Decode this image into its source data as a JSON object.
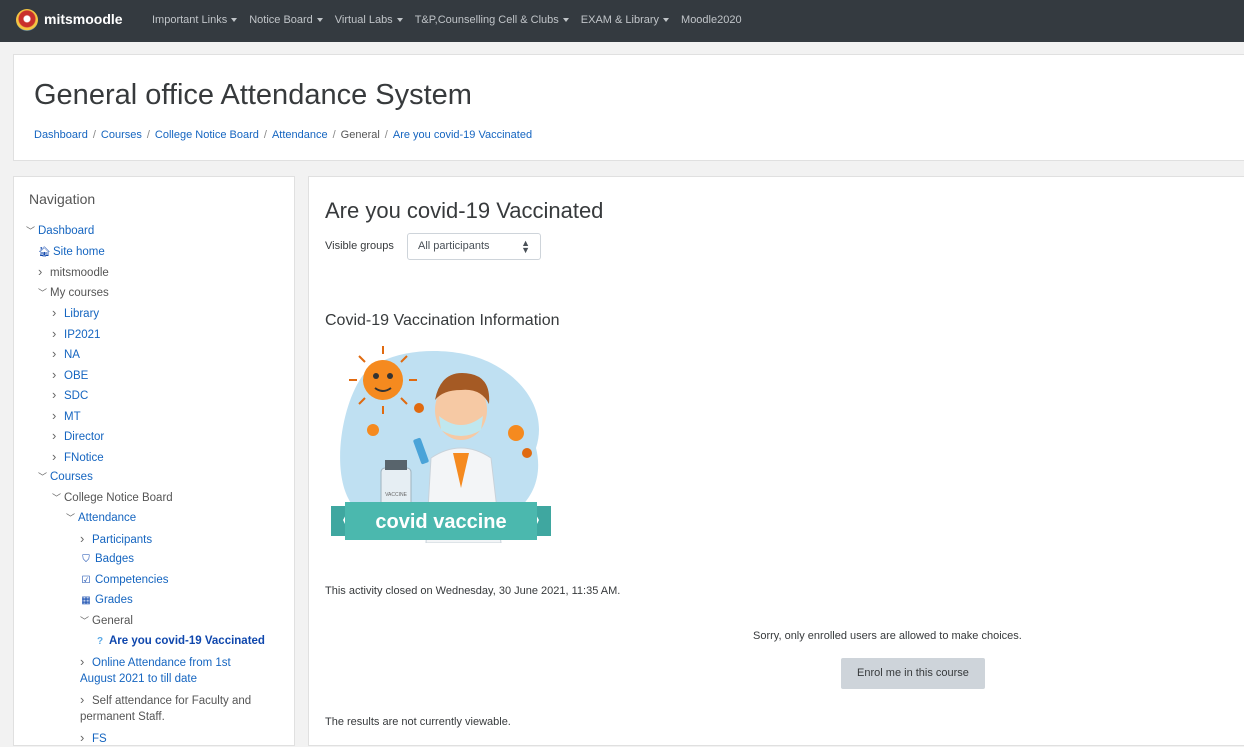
{
  "topbar": {
    "brand": "mitsmoodle",
    "menu": [
      {
        "label": "Important Links",
        "dropdown": true
      },
      {
        "label": "Notice Board",
        "dropdown": true
      },
      {
        "label": "Virtual Labs",
        "dropdown": true
      },
      {
        "label": "T&P,Counselling Cell & Clubs",
        "dropdown": true
      },
      {
        "label": "EXAM & Library",
        "dropdown": true
      },
      {
        "label": "Moodle2020",
        "dropdown": false
      }
    ]
  },
  "header": {
    "title": "General office Attendance System",
    "breadcrumb": [
      "Dashboard",
      "Courses",
      "College Notice Board",
      "Attendance",
      "General",
      "Are you covid-19 Vaccinated"
    ]
  },
  "navigation": {
    "title": "Navigation",
    "items": [
      {
        "label": "Dashboard",
        "toggle": "open",
        "icon": "",
        "style": "link",
        "depth": 0
      },
      {
        "label": "Site home",
        "toggle": "",
        "icon": "home-icon",
        "style": "link",
        "depth": 1
      },
      {
        "label": "mitsmoodle",
        "toggle": "closed",
        "icon": "",
        "style": "plain",
        "depth": 1
      },
      {
        "label": "My courses",
        "toggle": "open",
        "icon": "",
        "style": "plain",
        "depth": 1
      },
      {
        "label": "Library",
        "toggle": "closed",
        "icon": "",
        "style": "link",
        "depth": 2
      },
      {
        "label": "IP2021",
        "toggle": "closed",
        "icon": "",
        "style": "link",
        "depth": 2
      },
      {
        "label": "NA",
        "toggle": "closed",
        "icon": "",
        "style": "link",
        "depth": 2
      },
      {
        "label": "OBE",
        "toggle": "closed",
        "icon": "",
        "style": "link",
        "depth": 2
      },
      {
        "label": "SDC",
        "toggle": "closed",
        "icon": "",
        "style": "link",
        "depth": 2
      },
      {
        "label": "MT",
        "toggle": "closed",
        "icon": "",
        "style": "link",
        "depth": 2
      },
      {
        "label": "Director",
        "toggle": "closed",
        "icon": "",
        "style": "link",
        "depth": 2
      },
      {
        "label": "FNotice",
        "toggle": "closed",
        "icon": "",
        "style": "link",
        "depth": 2
      },
      {
        "label": "Courses",
        "toggle": "open",
        "icon": "",
        "style": "link",
        "depth": 1
      },
      {
        "label": "College Notice Board",
        "toggle": "open",
        "icon": "",
        "style": "plain",
        "depth": 2
      },
      {
        "label": "Attendance",
        "toggle": "open",
        "icon": "",
        "style": "link",
        "depth": 3
      },
      {
        "label": "Participants",
        "toggle": "closed",
        "icon": "",
        "style": "link",
        "depth": 4
      },
      {
        "label": "Badges",
        "toggle": "",
        "icon": "shield-icon",
        "style": "link",
        "depth": 4
      },
      {
        "label": "Competencies",
        "toggle": "",
        "icon": "checkbox-icon",
        "style": "link",
        "depth": 4
      },
      {
        "label": "Grades",
        "toggle": "",
        "icon": "table-icon",
        "style": "link",
        "depth": 4
      },
      {
        "label": "General",
        "toggle": "open",
        "icon": "",
        "style": "plain",
        "depth": 4
      },
      {
        "label": "Are you covid-19 Vaccinated",
        "toggle": "",
        "icon": "question-icon",
        "style": "active",
        "depth": 5
      },
      {
        "label": "Online Attendance from 1st",
        "label2": "August 2021 to till date",
        "toggle": "closed",
        "icon": "",
        "style": "link",
        "depth": 4
      },
      {
        "label": "Self attendance for Faculty and",
        "label2": "permanent Staff.",
        "toggle": "closed",
        "icon": "",
        "style": "plain",
        "depth": 4
      },
      {
        "label": "FS",
        "toggle": "closed",
        "icon": "",
        "style": "link",
        "depth": 4
      }
    ]
  },
  "main": {
    "title": "Are you covid-19 Vaccinated",
    "visible_groups_label": "Visible groups",
    "visible_groups_value": "All participants",
    "info_heading": "Covid-19 Vaccination Information",
    "banner_text": "covid vaccine",
    "vial_label": "VACCINE",
    "closed_text": "This activity closed on Wednesday, 30 June 2021, 11:35 AM.",
    "sorry_text": "Sorry, only enrolled users are allowed to make choices.",
    "enrol_button": "Enrol me in this course",
    "results_text": "The results are not currently viewable."
  },
  "colors": {
    "topbar": "#343a40",
    "link": "#1565c0",
    "active": "#0f47ad",
    "button": "#ced4da"
  }
}
